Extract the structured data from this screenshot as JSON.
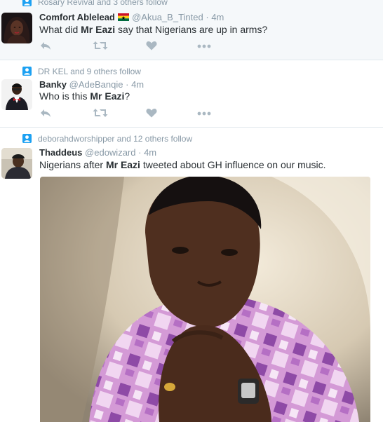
{
  "tweets": [
    {
      "context": "Rosary Revival and 3 others follow",
      "name": "Comfort Ablelead",
      "handle": "@Akua_B_Tinted",
      "dot": "·",
      "time": "4m",
      "text_parts": [
        "What did ",
        "Mr Eazi",
        " say that Nigerians are up in arms?"
      ]
    },
    {
      "context": "DR KEL and 9 others follow",
      "name": "Banky",
      "handle": "@AdeBanqie",
      "dot": "·",
      "time": "4m",
      "text_parts": [
        "Who is this ",
        "Mr Eazi",
        "?"
      ]
    },
    {
      "context": "deborahdworshipper and 12 others follow",
      "name": "Thaddeus",
      "handle": "@edowizard",
      "dot": "·",
      "time": "4m",
      "text_parts": [
        "Nigerians after ",
        "Mr Eazi",
        " tweeted about GH influence on our music."
      ]
    }
  ],
  "icons": {
    "context": "follow-person-icon",
    "flag": "ghana-flag-icon",
    "reply": "reply-icon",
    "retweet": "retweet-icon",
    "like": "heart-icon",
    "more": "more-dots-icon"
  },
  "colors": {
    "accent": "#1da1f2",
    "secondary_text": "#8899a6",
    "action_icon": "#aab8c2",
    "hover_bg": "#f5f8fa"
  }
}
